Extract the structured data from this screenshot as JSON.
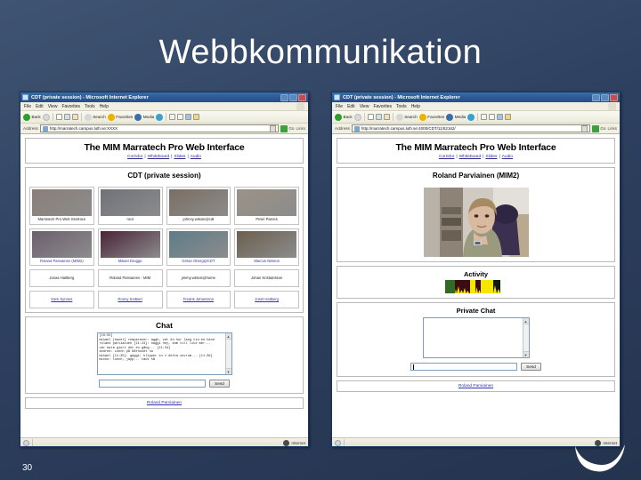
{
  "slide": {
    "title": "Webbkommunikation",
    "number": "30"
  },
  "browser": {
    "title": "CDT (private session) - Microsoft Internet Explorer",
    "menu": [
      "File",
      "Edit",
      "View",
      "Favorites",
      "Tools",
      "Help"
    ],
    "toolbar": [
      "Back",
      "Forward",
      "Stop",
      "Refresh",
      "Home",
      "Search",
      "Favorites",
      "Media",
      "History",
      "Mail",
      "Print",
      "Edit",
      "Discuss"
    ],
    "address_label": "Address",
    "go_label": "Go",
    "links_label": "Links",
    "status_zone": "Internet"
  },
  "left_window": {
    "address": "http://marratech.campus.luth.se:XXXX",
    "site_title": "The MIM Marratech Pro Web Interface",
    "nav": [
      "Corridor",
      "Whiteboard",
      "Slides",
      "Audio"
    ],
    "session_title": "CDT (private session)",
    "participants": [
      {
        "label": "Marratech Pro Web Interface",
        "link": false,
        "video": true,
        "tone": "#8a7f77"
      },
      {
        "label": "root",
        "link": false,
        "video": true,
        "tone": "#6f7278"
      },
      {
        "label": "johnny.wilson@cdt",
        "link": false,
        "video": true,
        "tone": "#7a6e62"
      },
      {
        "label": "Peter Parnes",
        "link": false,
        "video": true,
        "tone": "#9a9286"
      },
      {
        "label": "Roland Parviainen (MIM2)",
        "link": true,
        "video": true,
        "tone": "#6c5f6e"
      },
      {
        "label": "Mikael Drugge",
        "link": true,
        "video": true,
        "tone": "#4a2438"
      },
      {
        "label": "Göran Öberg@CDT",
        "link": true,
        "video": true,
        "tone": "#5d7c88"
      },
      {
        "label": "Marcus Nilsson",
        "link": true,
        "video": true,
        "tone": "#6b5f4f"
      },
      {
        "label": "Jonas Hallberg",
        "link": false,
        "video": false,
        "tone": "#ffffff"
      },
      {
        "label": "Roland Parviainen - MIM",
        "link": false,
        "video": false,
        "tone": "#ffffff"
      },
      {
        "label": "jimmy.wilson@home",
        "link": false,
        "video": false,
        "tone": "#ffffff"
      },
      {
        "label": "Johan Kristiansson",
        "link": false,
        "video": false,
        "tone": "#ffffff"
      },
      {
        "label": "Kåre Synnes",
        "link": true,
        "video": false,
        "tone": "#ffffff"
      },
      {
        "label": "Ronny Sellbert",
        "link": true,
        "video": false,
        "tone": "#ffffff"
      },
      {
        "label": "Fredrik Johansson",
        "link": true,
        "video": false,
        "tone": "#ffffff"
      },
      {
        "label": "Josef Hallberg",
        "link": true,
        "video": false,
        "tone": "#ffffff"
      }
    ],
    "chat_title": "Chat",
    "chat_log": "[10:55]\nmikael [hazel] reaparecer: aggh, vet du hur lang tid en hand\nroland parviainen [11:24]: oaggi hey, kom till lite mer...\nvar bara giort det en gång... [11:34]\nandree: Lunch på Kårhuset nu\nmikael [11:35]: gaggi: klipper in i detta sovrum... [11:36]\nmicke: lunch, japp... tack så",
    "chat_input_value": "",
    "send_label": "Send",
    "footer_link": "Roland Parviainen"
  },
  "right_window": {
    "address": "http://marratech.campus.luth.se:4000/CDT/11/52162/",
    "site_title": "The MIM Marratech Pro Web Interface",
    "nav": [
      "Corridor",
      "Whiteboard",
      "Slides",
      "Audio"
    ],
    "session_title": "Roland Parviainen (MIM2)",
    "activity_title": "Activity",
    "private_chat_title": "Private Chat",
    "private_chat_log": "",
    "private_chat_input_value": "",
    "send_label": "Send",
    "footer_link": "Roland Parviainen"
  }
}
